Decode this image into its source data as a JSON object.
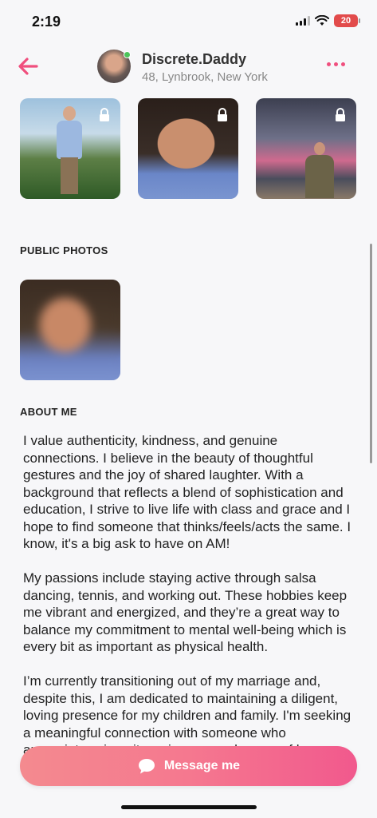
{
  "status_bar": {
    "time": "2:19",
    "battery": "20"
  },
  "header": {
    "username": "Discrete.Daddy",
    "location": "48, Lynbrook, New York",
    "back_icon": "back-arrow-icon",
    "more_icon": "more-options-icon"
  },
  "private_photos": [
    {
      "name": "private-photo-1",
      "locked": true
    },
    {
      "name": "private-photo-2",
      "locked": true
    },
    {
      "name": "private-photo-3",
      "locked": true
    }
  ],
  "public_photos": {
    "label": "PUBLIC PHOTOS"
  },
  "about_me": {
    "label": "ABOUT ME",
    "paragraphs": [
      "I value authenticity, kindness, and genuine connections. I believe in the beauty of thoughtful gestures and the joy of shared laughter. With a background that reflects a blend of sophistication and education, I strive to live life with class and grace and I hope to find someone that thinks/feels/acts the same.  I know, it's a big ask to have on AM!",
      "My passions include staying active through salsa dancing, tennis, and working out. These hobbies keep me vibrant and energized, and they’re a great way to balance my commitment to mental well-being which is every bit as important as physical health.",
      "I’m currently transitioning out of my marriage and, despite this, I am dedicated to maintaining a diligent, loving presence for my children and family. I'm seeking a meaningful connection with someone who appreciates sincerity, enjoys a good sense of humor, and values meaningful interactions. If"
    ]
  },
  "message_button": {
    "label": "Message me"
  },
  "colors": {
    "accent": "#f04f7e",
    "online": "#4cc45a"
  }
}
